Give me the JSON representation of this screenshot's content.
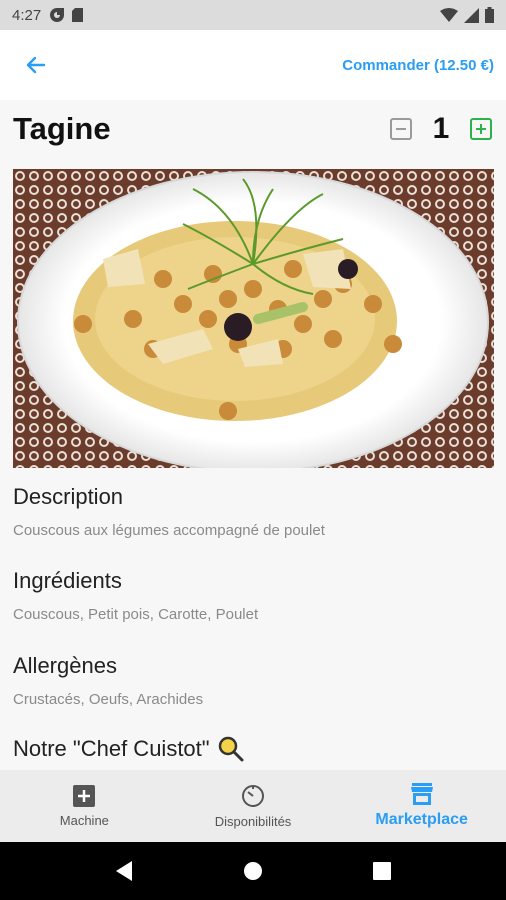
{
  "status_bar": {
    "time": "4:27"
  },
  "header": {
    "order_label": "Commander (12.50 €)"
  },
  "dish": {
    "title": "Tagine",
    "quantity": "1"
  },
  "sections": {
    "description": {
      "title": "Description",
      "text": "Couscous aux légumes accompagné de poulet"
    },
    "ingredients": {
      "title": "Ingrédients",
      "text": "Couscous, Petit pois, Carotte, Poulet"
    },
    "allergens": {
      "title": "Allergènes",
      "text": "Crustacés, Oeufs, Arachides"
    },
    "chef": {
      "title": "Notre \"Chef Cuistot\""
    }
  },
  "bottom_nav": {
    "machine": "Machine",
    "availability": "Disponibilités",
    "marketplace": "Marketplace"
  },
  "colors": {
    "accent": "#2a9df4",
    "plus": "#2bb24c",
    "minus": "#9a9a9a"
  }
}
